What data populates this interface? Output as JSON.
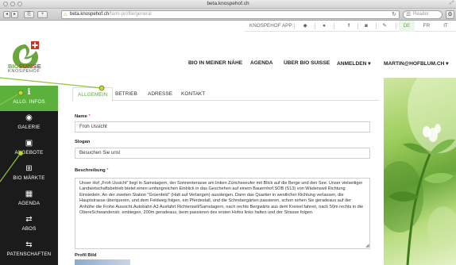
{
  "browser": {
    "window_title": "beta.knospehof.ch",
    "url_host": "beta.knospehof.ch",
    "url_path": "/farm-profile/general",
    "search_placeholder": "Reader",
    "back_icon": "back-arrow-icon",
    "forward_icon": "forward-arrow-icon"
  },
  "header": {
    "social_label": "KNOSPEHOF APP:",
    "languages": [
      "DE",
      "FR",
      "IT"
    ],
    "active_language": "DE",
    "accent_color": "#5cb03c",
    "logo": {
      "brand_bio": "BIO",
      "brand_suisse": "SUISSE",
      "subtitle": "KNOSPEHOF"
    },
    "nav": [
      {
        "label": "BIO IN MEINER NÄHE"
      },
      {
        "label": "AGENDA"
      },
      {
        "label": "ÜBER BIO SUISSE"
      },
      {
        "label": "ANMELDEN"
      },
      {
        "label": "MARTIN@HOFBLUM.CH"
      }
    ]
  },
  "sidebar": {
    "items": [
      {
        "label": "ALLG. INFOS",
        "icon": "info-icon",
        "active": true
      },
      {
        "label": "GALERIE",
        "icon": "camera-icon",
        "active": false
      },
      {
        "label": "ANGEBOTE",
        "icon": "gift-icon",
        "active": false
      },
      {
        "label": "BIO MÄRKTE",
        "icon": "cart-icon",
        "active": false
      },
      {
        "label": "AGENDA",
        "icon": "calendar-icon",
        "active": false
      },
      {
        "label": "ABOS",
        "icon": "repeat-icon",
        "active": false
      },
      {
        "label": "PATENSCHAFTEN",
        "icon": "exchange-icon",
        "active": false
      }
    ]
  },
  "tabs": [
    {
      "label": "ALLGEMEIN",
      "active": true
    },
    {
      "label": "BETRIEB",
      "active": false
    },
    {
      "label": "ADRESSE",
      "active": false
    },
    {
      "label": "KONTAKT",
      "active": false
    }
  ],
  "form": {
    "name_label": "Name",
    "name_value": "Froh Ussicht",
    "slogan_label": "Slogan",
    "slogan_value": "Besuchen Sie uns!",
    "description_label": "Beschreibung",
    "description_value": "Unser Hof „Froh Ussicht“ liegt in Samstagern, der Sonnenterasse am linken Zürichseeufer mit Blick auf die Berge und den See. Unser vielseitiger Landwirtschaftsbetrieb bietet einen umfangreichen Einblick in das Geschehen auf einem Bauernhof.SOB (S13) von Wädenswil Richtung Einsiedeln. An der zweiten Station \"Grüenfeld\" (Halt auf Verlangen) aussteigen. Dann das Quartier in westlicher Richtung verlassen, die Hauptstrasse überqueren, und dem Feldweg folgen, ein Pferdestall, und die Schrebergärten passieren, schon sehen Sie geradeaus auf der Anhöhe die Frohe Aussicht.Autobahn A3 Ausfahrt Richterswil/Samstagern, nach rechts Bergwärts aus dem Kreisel fahren, nach 50m rechts in die ObereSchwandenstr. einbiegen, 200m geradeaus, beim passieren des ersten Hofes links halten und der Strasse folgen.",
    "profile_label": "Profil Bild"
  }
}
